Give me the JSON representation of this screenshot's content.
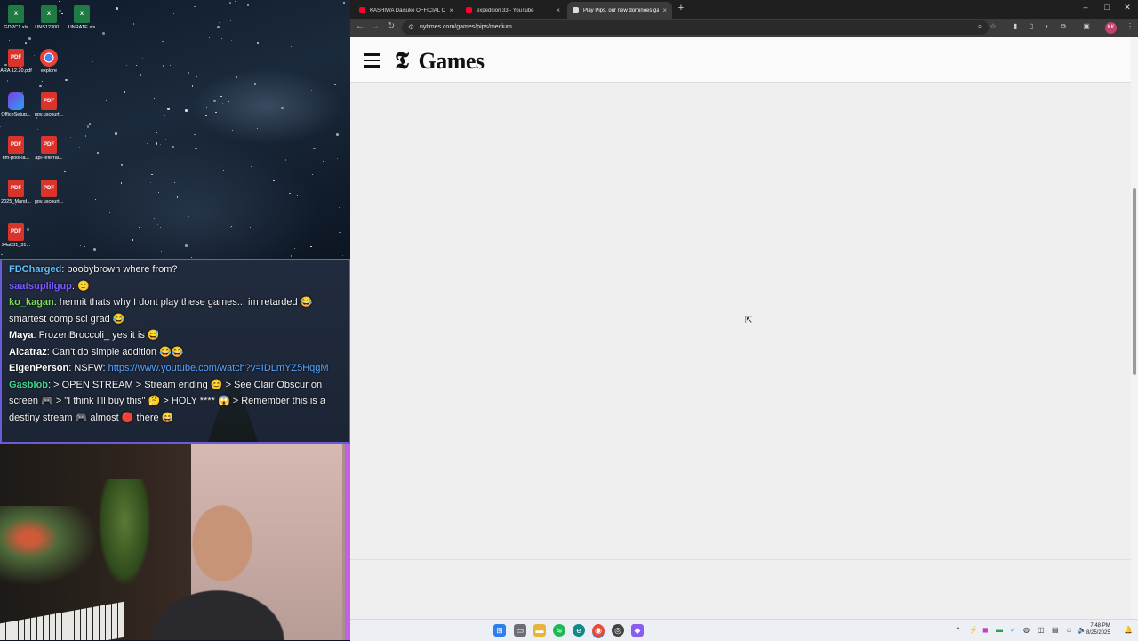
{
  "desktop": {
    "icons": [
      {
        "label": "GDPC1.xls",
        "type": "xls"
      },
      {
        "label": "UNS12300...",
        "type": "xls"
      },
      {
        "label": "UNRATE.xls",
        "type": "xls"
      },
      {
        "label": "ARA 12.20.pdf",
        "type": "pdf"
      },
      {
        "label": "explore",
        "type": "chrome"
      },
      {
        "label": "OfficeSetup...",
        "type": "office"
      },
      {
        "label": "gov.uscourt...",
        "type": "pdf"
      },
      {
        "label": "tim-pool-la...",
        "type": "pdf"
      },
      {
        "label": "apl-referral...",
        "type": "pdf"
      },
      {
        "label": "2025_Mand...",
        "type": "pdf"
      },
      {
        "label": "gov.uscourt...",
        "type": "pdf"
      },
      {
        "label": "24a831_31...",
        "type": "pdf"
      }
    ]
  },
  "chat": {
    "messages": [
      {
        "user": "FDCharged",
        "user_color": "#5bc0ff",
        "text": ": boobybrown where from?"
      },
      {
        "user": "saatsuplilgup",
        "user_color": "#7a5cff",
        "text": ": 🙂"
      },
      {
        "user": "ko_kagan",
        "user_color": "#7ddc5a",
        "text": ": hermit thats why I dont play these games... im retarded 😂"
      },
      {
        "user": "",
        "user_color": "#ffffff",
        "text": "smartest comp sci grad 😂"
      },
      {
        "user": "Maya",
        "user_color": "#ffffff",
        "text": ": FrozenBroccoli_ yes it is 😅"
      },
      {
        "user": "Alcatraz",
        "user_color": "#ffffff",
        "text": ": Can't do simple addition 😂😂"
      },
      {
        "user": "EigenPerson",
        "user_color": "#ffffff",
        "text": ": NSFW: ",
        "link": "https://www.youtube.com/watch?v=IDLmYZ5HqgM"
      },
      {
        "user": "Gasblob",
        "user_color": "#3dd68c",
        "text": ": > OPEN STREAM > Stream ending 😊 > See Clair Obscur on screen 🎮 > \"I think I'll buy this\" 🤔 > HOLY **** 😱 > Remember this is a destiny stream 🎮 almost 🔴 there 😄"
      }
    ]
  },
  "browser": {
    "tabs": [
      {
        "title": "KASHIWA Daisuke OFFICIAL CH",
        "fav_color": "#ff0033",
        "active": false
      },
      {
        "title": "expedition 33 - YouTube",
        "fav_color": "#ff0033",
        "active": false
      },
      {
        "title": "Play Pips, our new dominoes ga",
        "fav_color": "#dddddd",
        "active": true
      }
    ],
    "new_tab": "+",
    "url": "nytimes.com/games/pips/medium",
    "avatar_initials": "KK"
  },
  "site": {
    "logo_t": "𝕿",
    "logo_games": "Games"
  },
  "taskbar": {
    "time": "7:48 PM",
    "date": "8/25/2025"
  }
}
